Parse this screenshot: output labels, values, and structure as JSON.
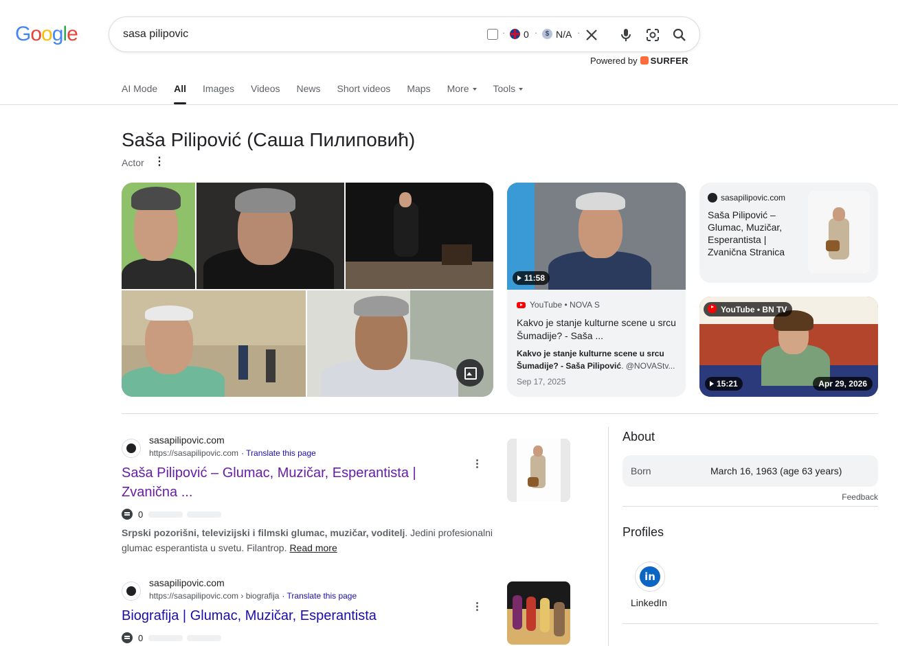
{
  "logo": {
    "text": "Google"
  },
  "search": {
    "query": "sasa pilipovic",
    "ext_count": "0",
    "ext_value": "N/A",
    "powered_prefix": "Powered by",
    "powered_brand": "SURFER"
  },
  "tabs": [
    {
      "label": "AI Mode"
    },
    {
      "label": "All"
    },
    {
      "label": "Images"
    },
    {
      "label": "Videos"
    },
    {
      "label": "News"
    },
    {
      "label": "Short videos"
    },
    {
      "label": "Maps"
    },
    {
      "label": "More"
    },
    {
      "label": "Tools"
    }
  ],
  "entity": {
    "title": "Saša Pilipović (Саша Пилиповић)",
    "subtitle": "Actor"
  },
  "video1": {
    "duration": "11:58",
    "source": "YouTube • NOVA S",
    "title": "Kakvo je stanje kulturne scene u srcu Šumadije? - Saša ...",
    "desc_bold": "Kakvo je stanje kulturne scene u srcu Šumadije? - Saša Pilipović",
    "desc_rest": ". @NOVAStv...",
    "date": "Sep 17, 2025"
  },
  "site_card": {
    "site": "sasapilipovic.com",
    "title": "Saša Pilipović – Glumac, Muzičar, Esperantista | Zvanična Stranica"
  },
  "video2": {
    "source": "YouTube • BN TV",
    "duration": "15:21",
    "date": "Apr 29, 2026"
  },
  "results": [
    {
      "site": "sasapilipovic.com",
      "url": "https://sasapilipovic.com",
      "translate": "· Translate this page",
      "title": "Saša Pilipović – Glumac, Muzičar, Esperantista | Zvanična ...",
      "count": "0",
      "snippet_bold": "Srpski pozorišni, televizijski i filmski glumac, muzičar, voditelj",
      "snippet_rest": ". Jedini profesionalni glumac esperantista u svetu. Filantrop.",
      "read_more": "Read more"
    },
    {
      "site": "sasapilipovic.com",
      "url": "https://sasapilipovic.com › biografija",
      "translate": "· Translate this page",
      "title": "Biografija | Glumac, Muzičar, Esperantista",
      "count": "0"
    }
  ],
  "about": {
    "heading": "About",
    "born_label": "Born",
    "born_value": "March 16, 1963 (age 63 years)",
    "feedback": "Feedback"
  },
  "profiles": {
    "heading": "Profiles",
    "items": [
      {
        "label": "LinkedIn",
        "icon": "linkedin-icon"
      }
    ]
  },
  "colors": {
    "link": "#1a0dab",
    "visited": "#681da8",
    "brand_blue": "#4285f4",
    "brand_red": "#ea4335",
    "brand_yellow": "#fbbc05",
    "brand_green": "#34a853"
  }
}
